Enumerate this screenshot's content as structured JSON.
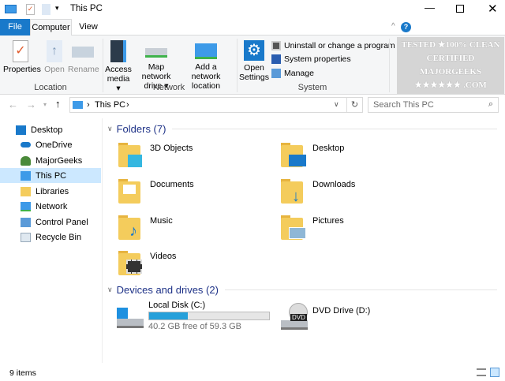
{
  "window": {
    "title": "This PC"
  },
  "tabs": [
    {
      "label": "File"
    },
    {
      "label": "Computer"
    },
    {
      "label": "View"
    }
  ],
  "ribbon": {
    "location": {
      "label": "Location",
      "buttons": [
        {
          "label": "Properties"
        },
        {
          "label": "Open"
        },
        {
          "label": "Rename"
        }
      ]
    },
    "network": {
      "label": "Network",
      "access_media": "Access media ▾",
      "map_drive": "Map network drive ▾",
      "add_location": "Add a network location"
    },
    "system": {
      "label": "System",
      "open_settings": "Open Settings",
      "uninstall": "Uninstall or change a program",
      "sys_props": "System properties",
      "manage": "Manage"
    },
    "watermark": "TESTED ★100% CLEAN CERTIFIED MAJORGEEKS .COM"
  },
  "address": {
    "path": "This PC",
    "search_placeholder": "Search This PC"
  },
  "nav": [
    {
      "label": "Desktop"
    },
    {
      "label": "OneDrive"
    },
    {
      "label": "MajorGeeks"
    },
    {
      "label": "This PC"
    },
    {
      "label": "Libraries"
    },
    {
      "label": "Network"
    },
    {
      "label": "Control Panel"
    },
    {
      "label": "Recycle Bin"
    }
  ],
  "folders": {
    "header": "Folders (7)",
    "items": [
      {
        "label": "3D Objects"
      },
      {
        "label": "Desktop"
      },
      {
        "label": "Documents"
      },
      {
        "label": "Downloads"
      },
      {
        "label": "Music"
      },
      {
        "label": "Pictures"
      },
      {
        "label": "Videos"
      }
    ]
  },
  "drives": {
    "header": "Devices and drives (2)",
    "items": [
      {
        "label": "Local Disk (C:)",
        "free": "40.2 GB free of 59.3 GB",
        "used_fraction": 0.32
      },
      {
        "label": "DVD Drive (D:)"
      }
    ]
  },
  "status": {
    "items": "9 items"
  },
  "colors": {
    "accent": "#1979ca",
    "bar": "#26a0da",
    "selected": "#cce8ff"
  }
}
